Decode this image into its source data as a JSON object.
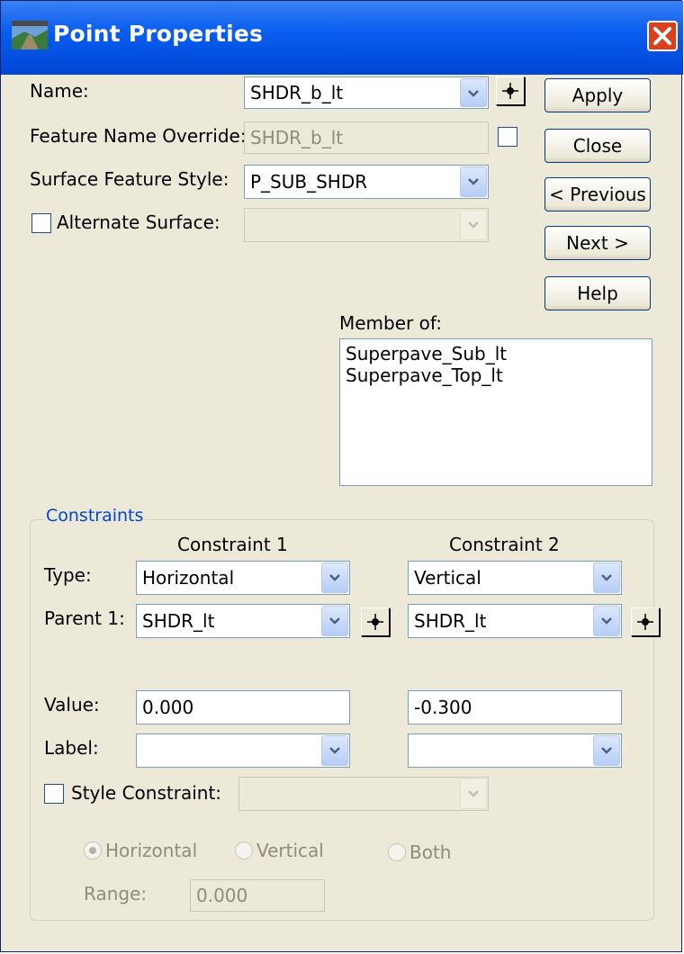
{
  "window": {
    "title": "Point Properties"
  },
  "name": {
    "label": "Name:",
    "value": "SHDR_b_lt"
  },
  "feature_override": {
    "label": "Feature Name Override:",
    "value": "SHDR_b_lt"
  },
  "surface_style": {
    "label": "Surface Feature Style:",
    "value": "P_SUB_SHDR"
  },
  "alt_surface": {
    "label": "Alternate Surface:",
    "value": ""
  },
  "buttons": {
    "apply": "Apply",
    "close": "Close",
    "previous": "< Previous",
    "next": "Next >",
    "help": "Help"
  },
  "member_of": {
    "label": "Member of:",
    "items": [
      "Superpave_Sub_lt",
      "Superpave_Top_lt"
    ]
  },
  "constraints": {
    "title": "Constraints",
    "col1": "Constraint 1",
    "col2": "Constraint 2",
    "type_label": "Type:",
    "parent_label": "Parent 1:",
    "value_label": "Value:",
    "label_label": "Label:",
    "c1": {
      "type": "Horizontal",
      "parent": "SHDR_lt",
      "value": "0.000",
      "label": ""
    },
    "c2": {
      "type": "Vertical",
      "parent": "SHDR_lt",
      "value": "-0.300",
      "label": ""
    },
    "style_constraint": {
      "label": "Style Constraint:",
      "value": ""
    },
    "radio_horizontal": "Horizontal",
    "radio_vertical": "Vertical",
    "radio_both": "Both",
    "range_label": "Range:",
    "range_value": "0.000"
  },
  "colors": {
    "titlebar": "#0054e3",
    "dialog_bg": "#ece9d8",
    "group_title": "#0046d5"
  }
}
